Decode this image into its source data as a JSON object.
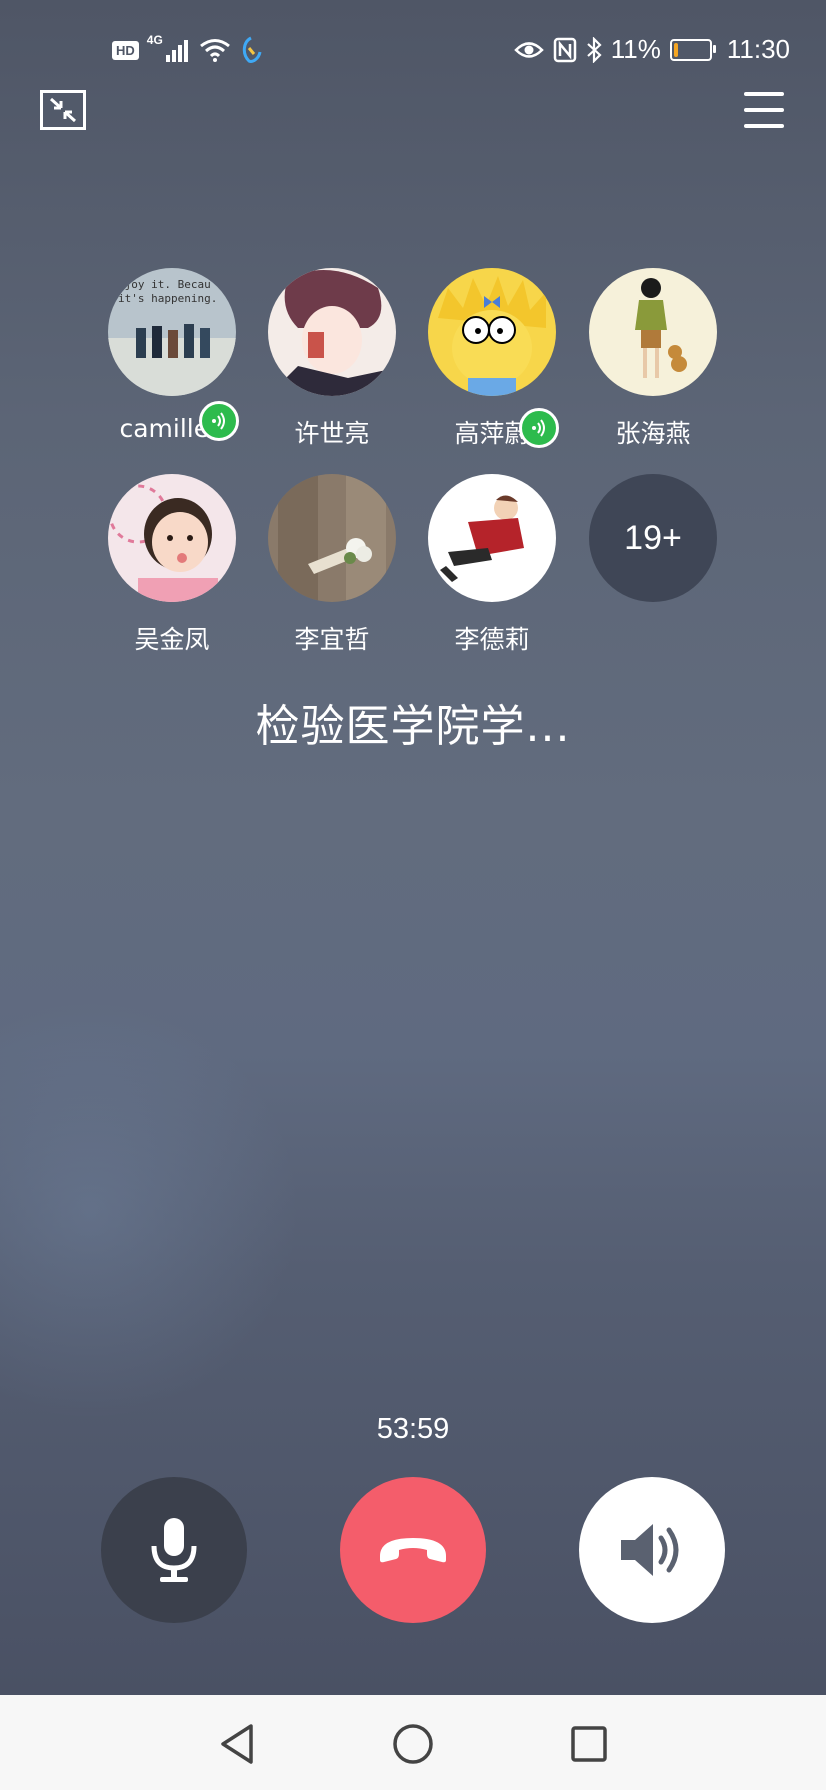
{
  "status_bar": {
    "hd_badge": "HD",
    "network_type": "4G",
    "battery_percent": "11%",
    "battery_level": 0.11,
    "time": "11:30",
    "icons": [
      "signal-icon",
      "wifi-icon",
      "call-app-icon",
      "eye-icon",
      "nfc-icon",
      "bluetooth-icon",
      "battery-icon"
    ]
  },
  "call": {
    "participants": [
      {
        "name": "camillee",
        "speaking": true
      },
      {
        "name": "许世亮",
        "speaking": false
      },
      {
        "name": "高萍蔚",
        "speaking": true
      },
      {
        "name": "张海燕",
        "speaking": false
      },
      {
        "name": "吴金凤",
        "speaking": false
      },
      {
        "name": "李宜哲",
        "speaking": false
      },
      {
        "name": "李德莉",
        "speaking": false
      }
    ],
    "avatar_text": {
      "camillee": "njoy it. Becau it's happening."
    },
    "more_count": "19+",
    "group_title": "检验医学院学...",
    "duration": "53:59"
  },
  "colors": {
    "background": "#5c6576",
    "hangup": "#f45d6b",
    "speaking_badge": "#2dbb4d",
    "mic_button": "#3b404c",
    "navbar": "#f7f7f7"
  },
  "controls": {
    "icons": [
      "microphone-icon",
      "hang-up-icon",
      "speaker-icon"
    ]
  },
  "nav": {
    "icons": [
      "back-icon",
      "home-icon",
      "recents-icon"
    ]
  }
}
